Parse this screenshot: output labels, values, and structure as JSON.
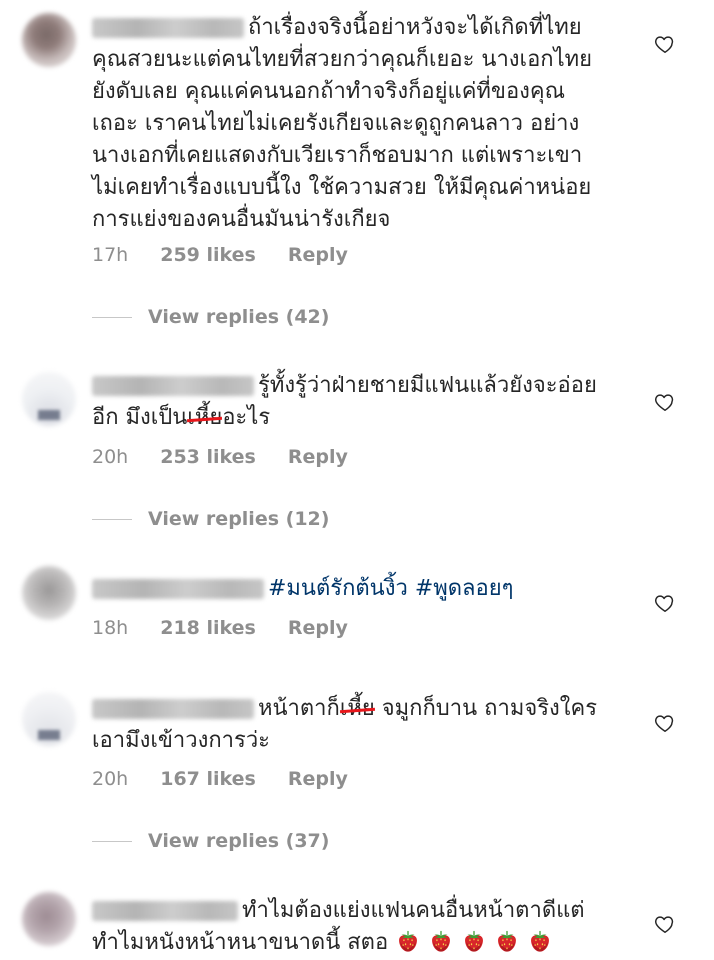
{
  "comments": [
    {
      "text_lines": [
        "ถ้าเรื่องจริงนี้อย่าหวังจะได้เกิดที่ไทย",
        "คุณสวยนะแต่คนไทยที่สวยกว่าคุณก็เยอะ นางเอกไทย",
        "ยังดับเลย คุณแค่คนนอกถ้าทำจริงก็อยู่แค่ที่ของคุณ",
        "เถอะ เราคนไทยไม่เคยรังเกียจและดูถูกคนลาว อย่าง",
        "นางเอกที่เคยแสดงกับเวียเราก็ชอบมาก แต่เพราะเขา",
        "ไม่เคยทำเรื่องแบบนี้ใง ใช้ความสวย ให้มีคุณค่าหน่อย",
        "การแย่งของคนอื่นมันน่ารังเกียจ"
      ],
      "time": "17h",
      "likes": "259 likes",
      "reply": "Reply",
      "view_replies": "View replies (42)"
    },
    {
      "text_lines": [
        "รู้ทั้งรู้ว่าฝ่ายชายมีแฟนแล้วยังจะอ่อย"
      ],
      "line2_pre": "อีก มึงเป็น",
      "line2_strike": "เหี้ย",
      "line2_post": "อะไร",
      "time": "20h",
      "likes": "253 likes",
      "reply": "Reply",
      "view_replies": "View replies (12)"
    },
    {
      "hashtags": "#มนต์รักต้นงิ้ว #พูดลอยๆ",
      "time": "18h",
      "likes": "218 likes",
      "reply": "Reply"
    },
    {
      "line1_pre": "หน้าตาก็",
      "line1_strike": "เหี้ย",
      "line1_post": " จมูกก็บาน ถามจริงใคร",
      "line2": "เอามึงเข้าวงการว่ะ",
      "time": "20h",
      "likes": "167 likes",
      "reply": "Reply",
      "view_replies": "View replies (37)"
    },
    {
      "line1": "ทำไมต้องแย่งแฟนคนอื่นหน้าตาดีแต่",
      "line2": "ทำไมหนังหน้าหนาขนาดนี้ สตอ",
      "emoji": "strawberry",
      "emoji_count": 5
    }
  ],
  "icons": {
    "like": "heart-outline-icon",
    "emoji": "strawberry-icon"
  },
  "colors": {
    "text": "#262626",
    "meta": "#8e8e8e",
    "hashtag": "#003569",
    "strike": "#e8161b"
  }
}
